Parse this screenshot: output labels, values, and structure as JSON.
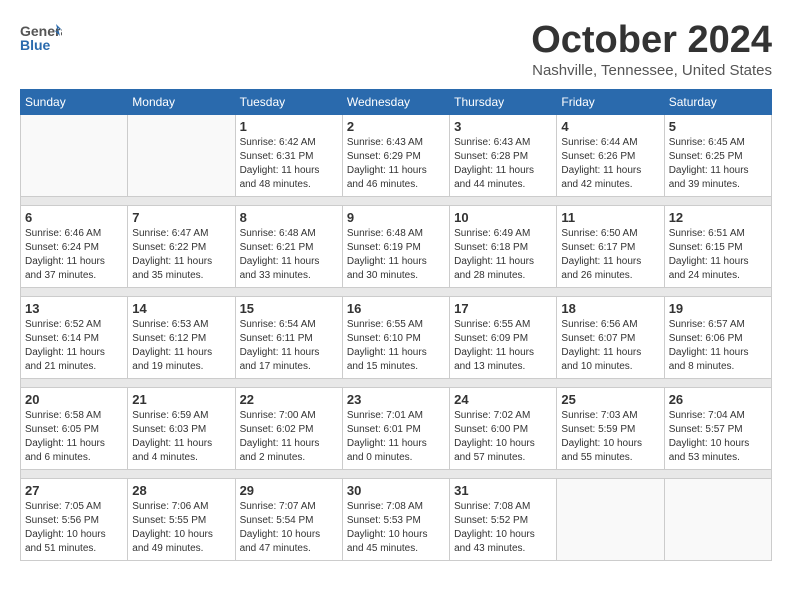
{
  "header": {
    "logo": {
      "general": "General",
      "blue": "Blue"
    },
    "title": "October 2024",
    "location": "Nashville, Tennessee, United States"
  },
  "weekdays": [
    "Sunday",
    "Monday",
    "Tuesday",
    "Wednesday",
    "Thursday",
    "Friday",
    "Saturday"
  ],
  "weeks": [
    [
      {
        "day": "",
        "info": ""
      },
      {
        "day": "",
        "info": ""
      },
      {
        "day": "1",
        "info": "Sunrise: 6:42 AM\nSunset: 6:31 PM\nDaylight: 11 hours and 48 minutes."
      },
      {
        "day": "2",
        "info": "Sunrise: 6:43 AM\nSunset: 6:29 PM\nDaylight: 11 hours and 46 minutes."
      },
      {
        "day": "3",
        "info": "Sunrise: 6:43 AM\nSunset: 6:28 PM\nDaylight: 11 hours and 44 minutes."
      },
      {
        "day": "4",
        "info": "Sunrise: 6:44 AM\nSunset: 6:26 PM\nDaylight: 11 hours and 42 minutes."
      },
      {
        "day": "5",
        "info": "Sunrise: 6:45 AM\nSunset: 6:25 PM\nDaylight: 11 hours and 39 minutes."
      }
    ],
    [
      {
        "day": "6",
        "info": "Sunrise: 6:46 AM\nSunset: 6:24 PM\nDaylight: 11 hours and 37 minutes."
      },
      {
        "day": "7",
        "info": "Sunrise: 6:47 AM\nSunset: 6:22 PM\nDaylight: 11 hours and 35 minutes."
      },
      {
        "day": "8",
        "info": "Sunrise: 6:48 AM\nSunset: 6:21 PM\nDaylight: 11 hours and 33 minutes."
      },
      {
        "day": "9",
        "info": "Sunrise: 6:48 AM\nSunset: 6:19 PM\nDaylight: 11 hours and 30 minutes."
      },
      {
        "day": "10",
        "info": "Sunrise: 6:49 AM\nSunset: 6:18 PM\nDaylight: 11 hours and 28 minutes."
      },
      {
        "day": "11",
        "info": "Sunrise: 6:50 AM\nSunset: 6:17 PM\nDaylight: 11 hours and 26 minutes."
      },
      {
        "day": "12",
        "info": "Sunrise: 6:51 AM\nSunset: 6:15 PM\nDaylight: 11 hours and 24 minutes."
      }
    ],
    [
      {
        "day": "13",
        "info": "Sunrise: 6:52 AM\nSunset: 6:14 PM\nDaylight: 11 hours and 21 minutes."
      },
      {
        "day": "14",
        "info": "Sunrise: 6:53 AM\nSunset: 6:12 PM\nDaylight: 11 hours and 19 minutes."
      },
      {
        "day": "15",
        "info": "Sunrise: 6:54 AM\nSunset: 6:11 PM\nDaylight: 11 hours and 17 minutes."
      },
      {
        "day": "16",
        "info": "Sunrise: 6:55 AM\nSunset: 6:10 PM\nDaylight: 11 hours and 15 minutes."
      },
      {
        "day": "17",
        "info": "Sunrise: 6:55 AM\nSunset: 6:09 PM\nDaylight: 11 hours and 13 minutes."
      },
      {
        "day": "18",
        "info": "Sunrise: 6:56 AM\nSunset: 6:07 PM\nDaylight: 11 hours and 10 minutes."
      },
      {
        "day": "19",
        "info": "Sunrise: 6:57 AM\nSunset: 6:06 PM\nDaylight: 11 hours and 8 minutes."
      }
    ],
    [
      {
        "day": "20",
        "info": "Sunrise: 6:58 AM\nSunset: 6:05 PM\nDaylight: 11 hours and 6 minutes."
      },
      {
        "day": "21",
        "info": "Sunrise: 6:59 AM\nSunset: 6:03 PM\nDaylight: 11 hours and 4 minutes."
      },
      {
        "day": "22",
        "info": "Sunrise: 7:00 AM\nSunset: 6:02 PM\nDaylight: 11 hours and 2 minutes."
      },
      {
        "day": "23",
        "info": "Sunrise: 7:01 AM\nSunset: 6:01 PM\nDaylight: 11 hours and 0 minutes."
      },
      {
        "day": "24",
        "info": "Sunrise: 7:02 AM\nSunset: 6:00 PM\nDaylight: 10 hours and 57 minutes."
      },
      {
        "day": "25",
        "info": "Sunrise: 7:03 AM\nSunset: 5:59 PM\nDaylight: 10 hours and 55 minutes."
      },
      {
        "day": "26",
        "info": "Sunrise: 7:04 AM\nSunset: 5:57 PM\nDaylight: 10 hours and 53 minutes."
      }
    ],
    [
      {
        "day": "27",
        "info": "Sunrise: 7:05 AM\nSunset: 5:56 PM\nDaylight: 10 hours and 51 minutes."
      },
      {
        "day": "28",
        "info": "Sunrise: 7:06 AM\nSunset: 5:55 PM\nDaylight: 10 hours and 49 minutes."
      },
      {
        "day": "29",
        "info": "Sunrise: 7:07 AM\nSunset: 5:54 PM\nDaylight: 10 hours and 47 minutes."
      },
      {
        "day": "30",
        "info": "Sunrise: 7:08 AM\nSunset: 5:53 PM\nDaylight: 10 hours and 45 minutes."
      },
      {
        "day": "31",
        "info": "Sunrise: 7:08 AM\nSunset: 5:52 PM\nDaylight: 10 hours and 43 minutes."
      },
      {
        "day": "",
        "info": ""
      },
      {
        "day": "",
        "info": ""
      }
    ]
  ]
}
